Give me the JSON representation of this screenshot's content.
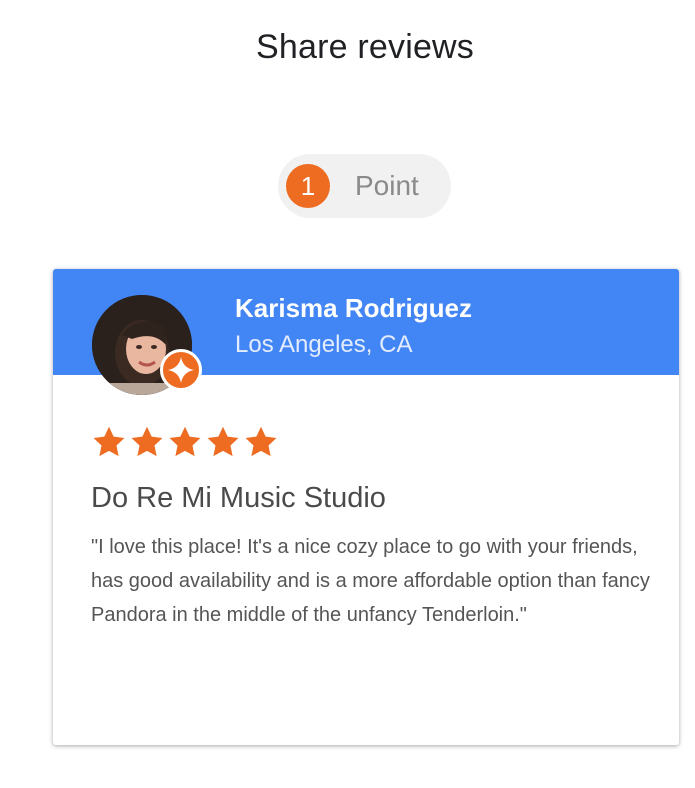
{
  "page": {
    "title": "Share reviews"
  },
  "points": {
    "count": "1",
    "label": "Point"
  },
  "review": {
    "reviewer_name": "Karisma Rodriguez",
    "reviewer_location": "Los Angeles, CA",
    "rating": 5,
    "rating_max": 5,
    "place_name": "Do Re Mi Music Studio",
    "text": "\"I love this place! It's a nice cozy place to go with your friends, has good availability and is a more affordable option than fancy Pandora in the middle of the unfancy Tenderloin.\""
  },
  "icons": {
    "badge": "local-guide-sparkle-icon",
    "star": "star-icon"
  },
  "colors": {
    "header_blue": "#4285f4",
    "accent_orange": "#ee6c22",
    "pill_bg": "#f1f1f1"
  }
}
